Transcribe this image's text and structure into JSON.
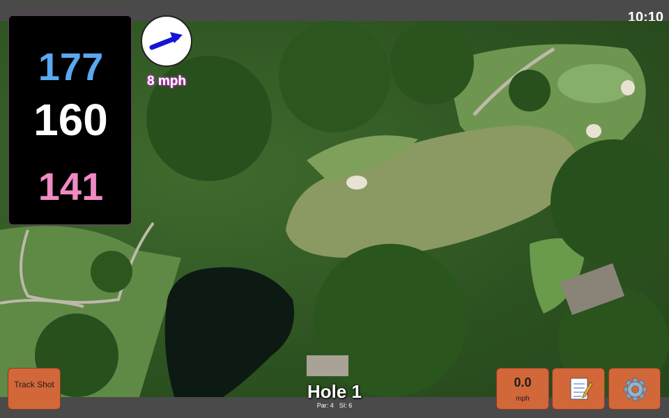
{
  "status_bar": {
    "time": "10:10"
  },
  "yardage": {
    "back": "177",
    "center": "160",
    "front": "141"
  },
  "wind": {
    "speed": "8 mph",
    "direction_icon": "arrow-right-icon"
  },
  "hole": {
    "title": "Hole 1",
    "par": "Par: 4",
    "si": "SI: 6"
  },
  "buttons": {
    "track_shot": "Track Shot",
    "speed_value": "0.0",
    "speed_unit": "mph",
    "notes_icon": "notepad-icon",
    "settings_icon": "gear-icon"
  },
  "colors": {
    "back_yardage": "#5aa8f0",
    "center_yardage": "#ffffff",
    "front_yardage": "#f08ac4",
    "button": "#d2673a"
  }
}
